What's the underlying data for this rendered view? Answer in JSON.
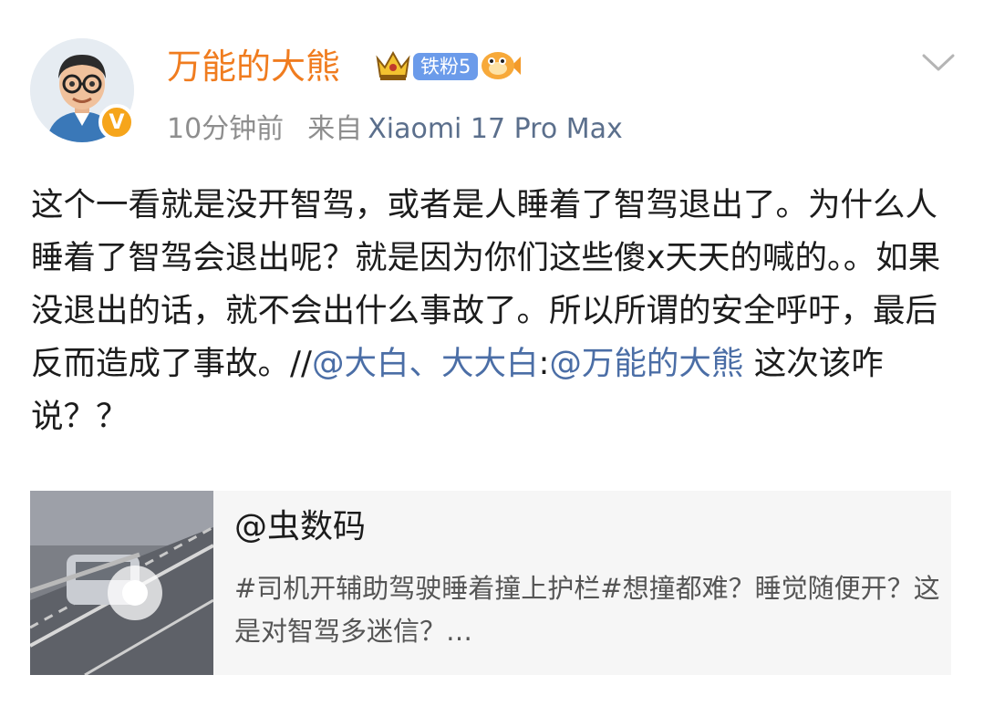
{
  "user": {
    "name": "万能的大熊",
    "fan_badge": "铁粉5",
    "verified_mark": "V"
  },
  "meta": {
    "time": "10分钟前",
    "source_prefix": "来自",
    "device": "Xiaomi 17 Pro Max"
  },
  "post": {
    "text": "这个一看就是没开智驾，或者是人睡着了智驾退出了。为什么人睡着了智驾会退出呢？就是因为你们这些傻x天天的喊的。。如果没退出的话，就不会出什么事故了。所以所谓的安全呼吁，最后反而造成了事故。",
    "repost_sep": "//",
    "mention1": "@大白、大大白",
    "colon": ":",
    "mention2": "@万能的大熊",
    "tail": " 这次该咋说？？"
  },
  "card": {
    "author": "@虫数码",
    "desc": "#司机开辅助驾驶睡着撞上护栏#想撞都难？睡觉随便开？这是对智驾多迷信？…"
  },
  "icons": {
    "avatar": "cartoon-man-avatar",
    "crown": "crown-icon",
    "fish": "fish-emoji-icon",
    "chevron": "chevron-down-icon"
  },
  "colors": {
    "username": "#f07c1f",
    "link": "#4b6ea6",
    "fan_badge": "#6b9bea",
    "verified": "#f6a51b"
  }
}
